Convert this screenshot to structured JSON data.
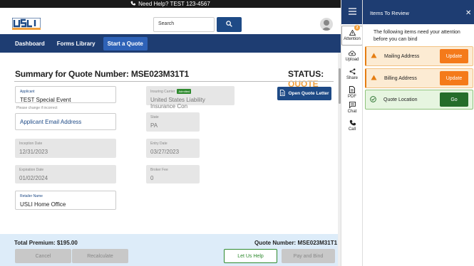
{
  "topbar": {
    "help_text": "Need Help? TEST 123-4567"
  },
  "header": {
    "search_placeholder": "Search"
  },
  "nav": {
    "items": [
      "Dashboard",
      "Forms Library",
      "Start a Quote"
    ],
    "active_index": 2
  },
  "summary": {
    "title": "Summary for Quote Number: MSE023M31T1",
    "status_label": "STATUS:",
    "status_value": "QUOTE",
    "open_letter_label": "Open Quote Letter"
  },
  "fields": {
    "applicant": {
      "label": "Applicant",
      "value": "TEST Special Event",
      "hint": "Please change if incorrect"
    },
    "applicant_email": {
      "value": "Applicant Email Address"
    },
    "insuring_carrier": {
      "label": "Insuring Carrier",
      "badge": "Admitted",
      "value": "United States Liability Insurance Con"
    },
    "state": {
      "label": "State",
      "value": "PA"
    },
    "inception_date": {
      "label": "Inception Date",
      "value": "12/31/2023"
    },
    "entry_date": {
      "label": "Entry Date",
      "value": "03/27/2023"
    },
    "expiration_date": {
      "label": "Expiration Date",
      "value": "01/02/2024"
    },
    "broker_fee": {
      "label": "Broker Fee",
      "value": "0"
    },
    "retailer_name": {
      "label": "Retailer Name",
      "value": "USLI Home Office"
    }
  },
  "footer": {
    "total_premium": "Total Premium:  $195.00",
    "quote_number": "Quote Number: MSE023M31T1",
    "cancel_label": "Cancel",
    "recalculate_label": "Recalculate",
    "let_us_help_label": "Let Us Help",
    "pay_bind_label": "Pay and Bind"
  },
  "toolbar": {
    "attention_count": "2",
    "items": [
      "Attention",
      "Upload",
      "Share",
      "PDF",
      "Chat",
      "Call"
    ]
  },
  "panel": {
    "title": "Items To Review",
    "intro": "The following items need your attention before you can bind",
    "items": [
      {
        "label": "Mailing Address",
        "button": "Update"
      },
      {
        "label": "Billing Address",
        "button": "Update"
      },
      {
        "label": "Quote Location",
        "button": "Go"
      }
    ]
  },
  "colors": {
    "navy": "#1e3d72",
    "accent_orange": "#f2a03c",
    "update_orange": "#f47a1a",
    "go_green": "#256d2a"
  }
}
